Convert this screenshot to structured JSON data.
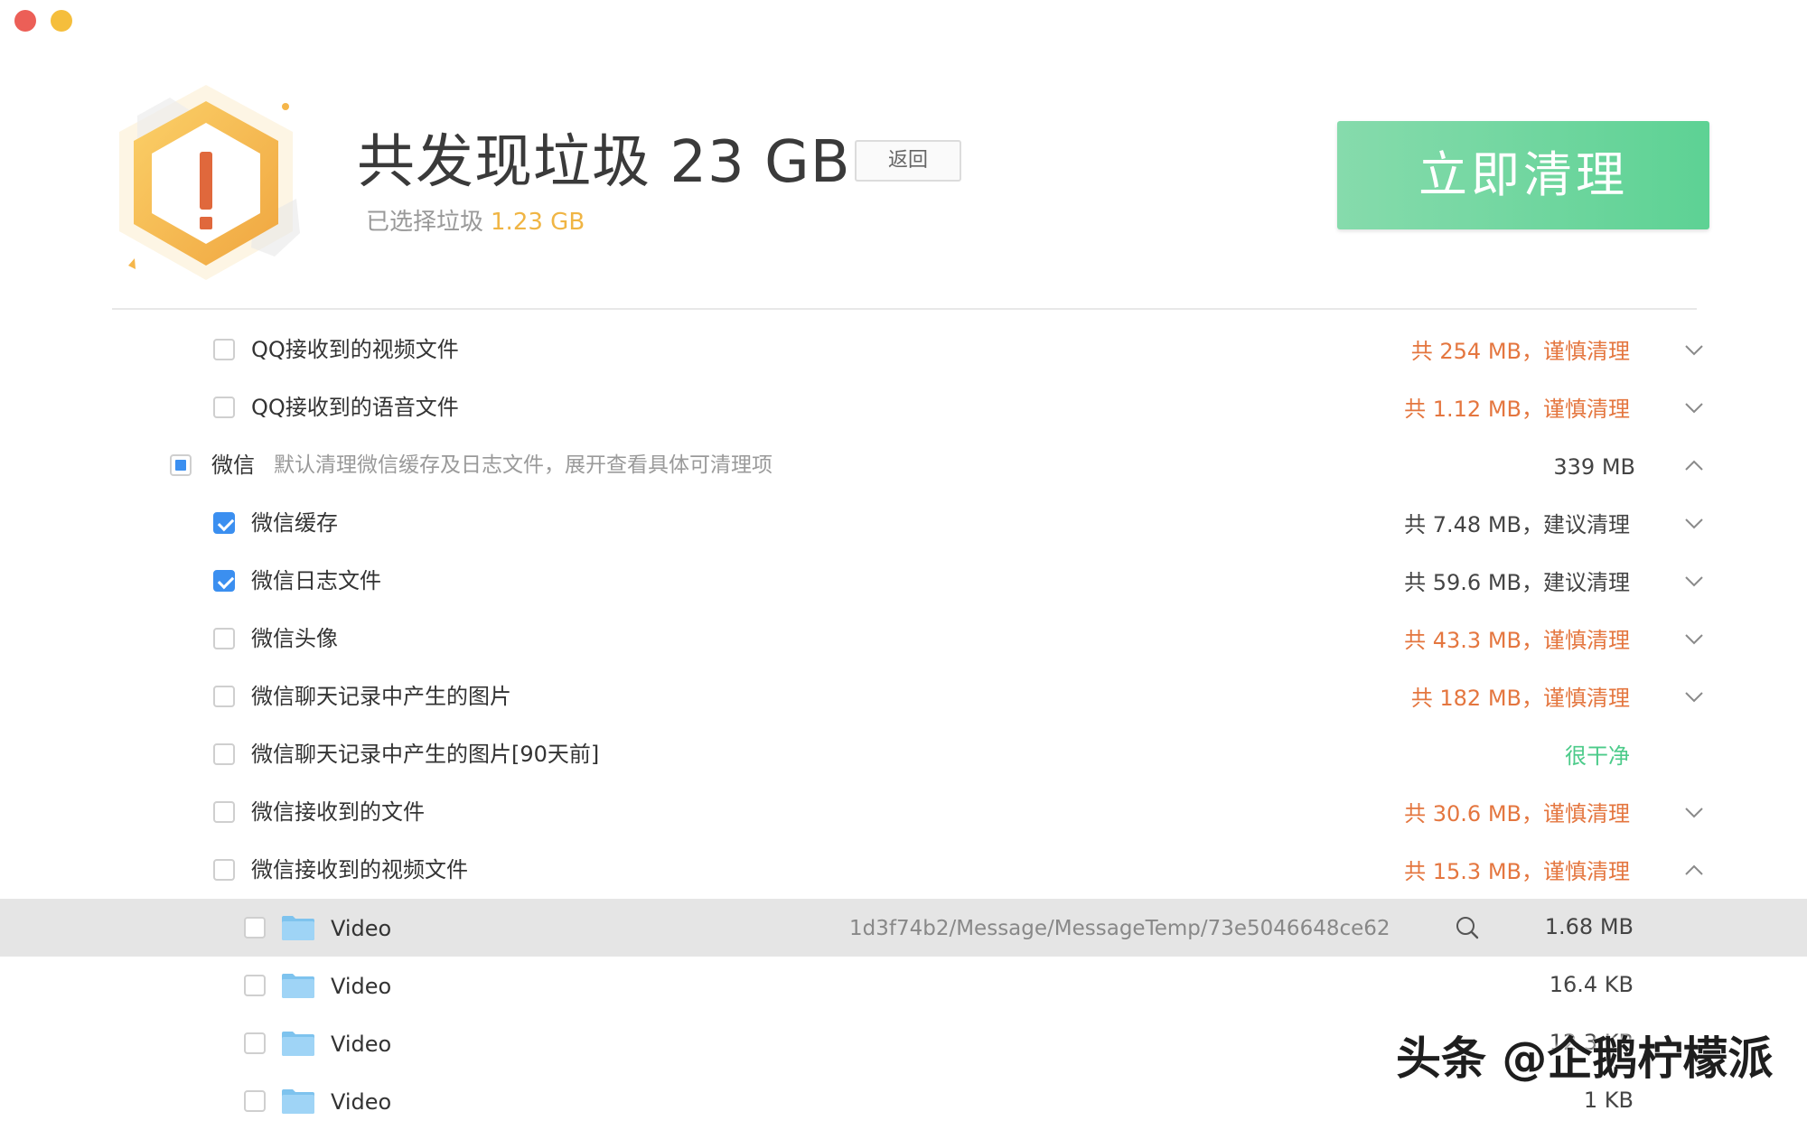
{
  "window": {
    "close_color": "#ec5f57",
    "minimize_color": "#f5be3c"
  },
  "header": {
    "icon": "warning-hexagon-icon",
    "title": "共发现垃圾 23 GB",
    "back_label": "返回",
    "selected_label": "已选择垃圾",
    "selected_amount": "1.23 GB",
    "clean_label": "立即清理"
  },
  "items": [
    {
      "label": "QQ接收到的视频文件",
      "status": "共 254 MB，谨慎清理",
      "checked": false,
      "expanded": false
    },
    {
      "label": "QQ接收到的语音文件",
      "status": "共 1.12 MB，谨慎清理",
      "checked": false,
      "expanded": false
    },
    {
      "label": "微信",
      "description": "默认清理微信缓存及日志文件，展开查看具体可清理项",
      "size": "339 MB",
      "checked": "partial",
      "expanded": true
    },
    {
      "label": "微信缓存",
      "status": "共 7.48 MB，建议清理",
      "checked": true,
      "expanded": false
    },
    {
      "label": "微信日志文件",
      "status": "共 59.6 MB，建议清理",
      "checked": true,
      "expanded": false
    },
    {
      "label": "微信头像",
      "status": "共 43.3 MB，谨慎清理",
      "checked": false,
      "expanded": false
    },
    {
      "label": "微信聊天记录中产生的图片",
      "status": "共 182 MB，谨慎清理",
      "checked": false,
      "expanded": false
    },
    {
      "label": "微信聊天记录中产生的图片[90天前]",
      "status": "很干净",
      "checked": false
    },
    {
      "label": "微信接收到的文件",
      "status": "共 30.6 MB，谨慎清理",
      "checked": false,
      "expanded": false
    },
    {
      "label": "微信接收到的视频文件",
      "status": "共 15.3 MB，谨慎清理",
      "checked": false,
      "expanded": true
    }
  ],
  "files": [
    {
      "name": "Video",
      "path": "1d3f74b2/Message/MessageTemp/73e5046648ce62",
      "size": "1.68 MB",
      "icon": "folder-icon"
    },
    {
      "name": "Video",
      "size": "16.4 KB",
      "icon": "folder-icon"
    },
    {
      "name": "Video",
      "size": "12.3 KB",
      "icon": "folder-icon"
    },
    {
      "name": "Video",
      "size": "1 KB",
      "icon": "folder-icon"
    }
  ],
  "watermark": "头条 @企鹅柠檬派",
  "colors": {
    "caution": "#e4763f",
    "clean": "#4ccb8a",
    "accent_green": "#5dd294",
    "checkbox_blue": "#3b8ff0",
    "selected_amount": "#f0b544"
  }
}
